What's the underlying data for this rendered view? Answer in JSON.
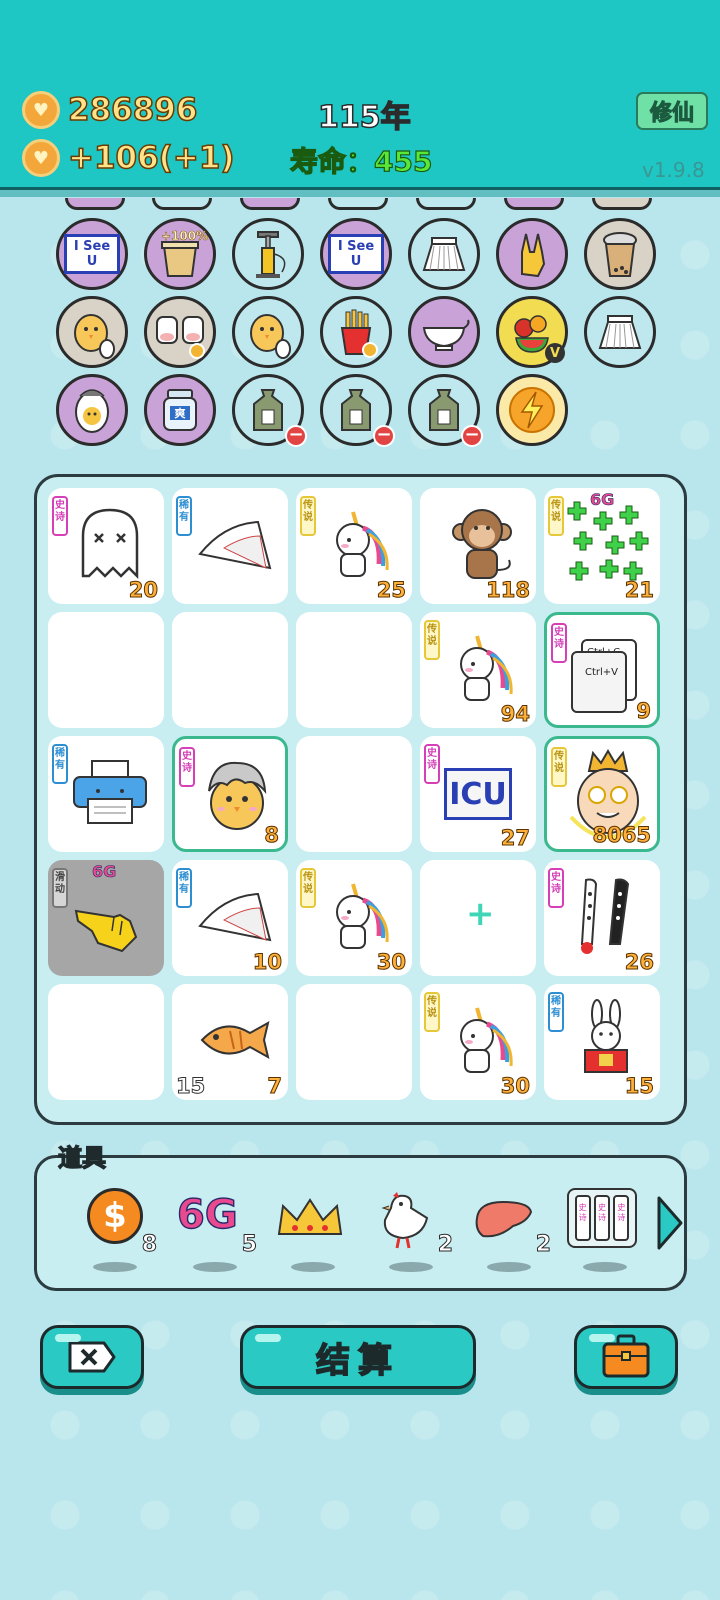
{
  "header": {
    "coins": "286896",
    "income": "+106(+1)",
    "year": "115年",
    "life_label": "寿命：455",
    "xiuxian_label": "修仙",
    "version": "v1.9.8",
    "coin_icon": "heart-coin-icon"
  },
  "owned_items": [
    {
      "name": "iseeu",
      "text": "I See U"
    },
    {
      "name": "bucket-100",
      "text": "+100%"
    },
    {
      "name": "pump",
      "text": ""
    },
    {
      "name": "iseeu-2",
      "text": "I See U"
    },
    {
      "name": "skirt",
      "text": ""
    },
    {
      "name": "rock-hand",
      "text": ""
    },
    {
      "name": "bubble-tea",
      "text": ""
    },
    {
      "name": "chick-egg",
      "text": ""
    },
    {
      "name": "cow-twins",
      "text": ""
    },
    {
      "name": "chick-egg-2",
      "text": ""
    },
    {
      "name": "fries",
      "text": ""
    },
    {
      "name": "gravy-boat",
      "text": ""
    },
    {
      "name": "fruit-plate",
      "text": "V"
    },
    {
      "name": "skirt-2",
      "text": ""
    },
    {
      "name": "egg-face",
      "text": ""
    },
    {
      "name": "jar",
      "text": "爽"
    },
    {
      "name": "trash-bag",
      "text": ""
    },
    {
      "name": "trash-bag-2",
      "text": ""
    },
    {
      "name": "trash-bag-3",
      "text": ""
    },
    {
      "name": "lightning",
      "text": ""
    }
  ],
  "board": {
    "cells": [
      {
        "tag": "史诗",
        "rarity": "epic",
        "icon": "ghost",
        "count": "20"
      },
      {
        "tag": "稀有",
        "rarity": "rare",
        "icon": "fan",
        "count": ""
      },
      {
        "tag": "传说",
        "rarity": "legend",
        "icon": "unicorn",
        "count": "25"
      },
      {
        "tag": "",
        "rarity": "",
        "icon": "monkey",
        "count": "118"
      },
      {
        "tag": "传说",
        "rarity": "legend",
        "icon": "green-plus-6g",
        "count": "21",
        "label": "6G"
      },
      {
        "tag": "",
        "rarity": "",
        "icon": "",
        "count": ""
      },
      {
        "tag": "",
        "rarity": "",
        "icon": "",
        "count": ""
      },
      {
        "tag": "",
        "rarity": "",
        "icon": "",
        "count": ""
      },
      {
        "tag": "传说",
        "rarity": "legend",
        "icon": "unicorn",
        "count": "94"
      },
      {
        "tag": "史诗",
        "rarity": "epic",
        "icon": "ctrl-cv",
        "count": "9",
        "line1": "Ctrl+C",
        "line2": "Ctrl+V"
      },
      {
        "tag": "稀有",
        "rarity": "rare",
        "icon": "printer",
        "count": ""
      },
      {
        "tag": "史诗",
        "rarity": "epic",
        "icon": "chick-silver-hair",
        "count": "8"
      },
      {
        "tag": "",
        "rarity": "",
        "icon": "",
        "count": ""
      },
      {
        "tag": "史诗",
        "rarity": "epic",
        "icon": "icu",
        "count": "27",
        "label": "ICU"
      },
      {
        "tag": "传说",
        "rarity": "legend",
        "icon": "king-face",
        "count": "8065"
      },
      {
        "tag": "滑动",
        "rarity": "gray",
        "icon": "pointing-hand",
        "count": "",
        "label": "6G"
      },
      {
        "tag": "稀有",
        "rarity": "rare",
        "icon": "fan",
        "count": "10"
      },
      {
        "tag": "传说",
        "rarity": "legend",
        "icon": "unicorn",
        "count": "30"
      },
      {
        "tag": "",
        "rarity": "",
        "icon": "plus",
        "count": ""
      },
      {
        "tag": "史诗",
        "rarity": "epic",
        "icon": "popsicles",
        "count": "26"
      },
      {
        "tag": "",
        "rarity": "",
        "icon": "",
        "count": ""
      },
      {
        "tag": "",
        "rarity": "",
        "icon": "fish",
        "count": "7",
        "count_left": "15"
      },
      {
        "tag": "",
        "rarity": "",
        "icon": "",
        "count": ""
      },
      {
        "tag": "传说",
        "rarity": "legend",
        "icon": "unicorn",
        "count": "30"
      },
      {
        "tag": "稀有",
        "rarity": "rare",
        "icon": "rabbit",
        "count": "15"
      }
    ]
  },
  "props": {
    "title": "道具",
    "items": [
      {
        "icon": "dollar-coin-icon",
        "glyph": "$",
        "count": "8"
      },
      {
        "icon": "6g-icon",
        "glyph": "6G",
        "count": "5"
      },
      {
        "icon": "crown-icon",
        "glyph": "",
        "count": ""
      },
      {
        "icon": "pigeon-icon",
        "glyph": "",
        "count": "2"
      },
      {
        "icon": "liver-icon",
        "glyph": "",
        "count": "2"
      },
      {
        "icon": "triple-card-icon",
        "glyph": "史诗",
        "count": ""
      }
    ]
  },
  "footer": {
    "close_icon": "close-x-icon",
    "settle_label": "结算",
    "bag_icon": "briefcase-icon"
  },
  "colors": {
    "header_bg": "#1ec7c4",
    "body_bg": "#b9e6ec",
    "coin_text": "#ffe28a",
    "life_text": "#59e83a",
    "count_text": "#ffb03a",
    "epic": "#d53fb7",
    "rare": "#2d8fd2",
    "legend": "#e7c73a"
  }
}
